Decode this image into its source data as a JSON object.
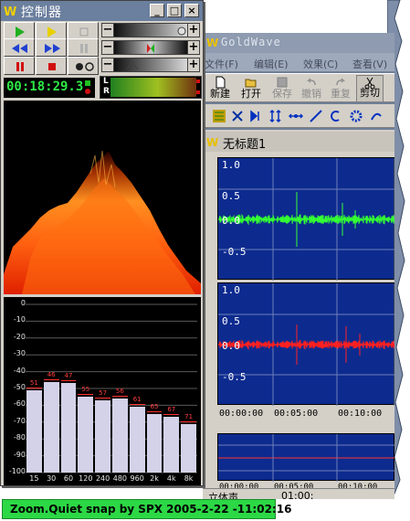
{
  "control_window": {
    "title": "控制器",
    "caption_buttons": [
      "_",
      "□",
      "×"
    ],
    "time_display": "00:18:29.3",
    "meter_channels": [
      "L",
      "R"
    ]
  },
  "goldwave_window": {
    "title": "GoldWave",
    "menu": [
      "文件(F)",
      "编辑(E)",
      "效果(C)",
      "查看(V)"
    ],
    "toolbar": [
      "新建",
      "打开",
      "保存",
      "撤销",
      "重复",
      "剪切"
    ],
    "document_title": "无标题1",
    "amplitude_ticks": [
      "1.0",
      "0.5",
      "0.0",
      "-0.5"
    ],
    "time_ticks": [
      "00:00:00",
      "00:05:00",
      "00:10:00"
    ],
    "overview_ticks": [
      "00:00:00",
      "00:05:00",
      "00:10:00"
    ],
    "status": {
      "mode": "立体声",
      "time": "01:00:"
    }
  },
  "equalizer": {
    "y_ticks": [
      "0",
      "-10",
      "-20",
      "-30",
      "-40",
      "-50",
      "-60",
      "-70",
      "-80",
      "-90",
      "-100"
    ],
    "bands": [
      "15",
      "30",
      "60",
      "120",
      "240",
      "480",
      "960",
      "2k",
      "4k",
      "8k"
    ],
    "values": [
      -51,
      -46,
      -47,
      -55,
      -57,
      -56,
      -61,
      -65,
      -67,
      -71
    ],
    "value_labels": [
      "51",
      "46",
      "47",
      "55",
      "57",
      "56",
      "61",
      "65",
      "67",
      "71"
    ]
  },
  "watermark": "Zoom.Quiet snap by SPX 2005-2-22 -11:02:16",
  "colors": {
    "clock": "#2ee846",
    "wave_left": "#33ff33",
    "wave_right": "#ff2020",
    "wave_bg": "#0d2b8f",
    "snap_bg": "#2cd845"
  }
}
